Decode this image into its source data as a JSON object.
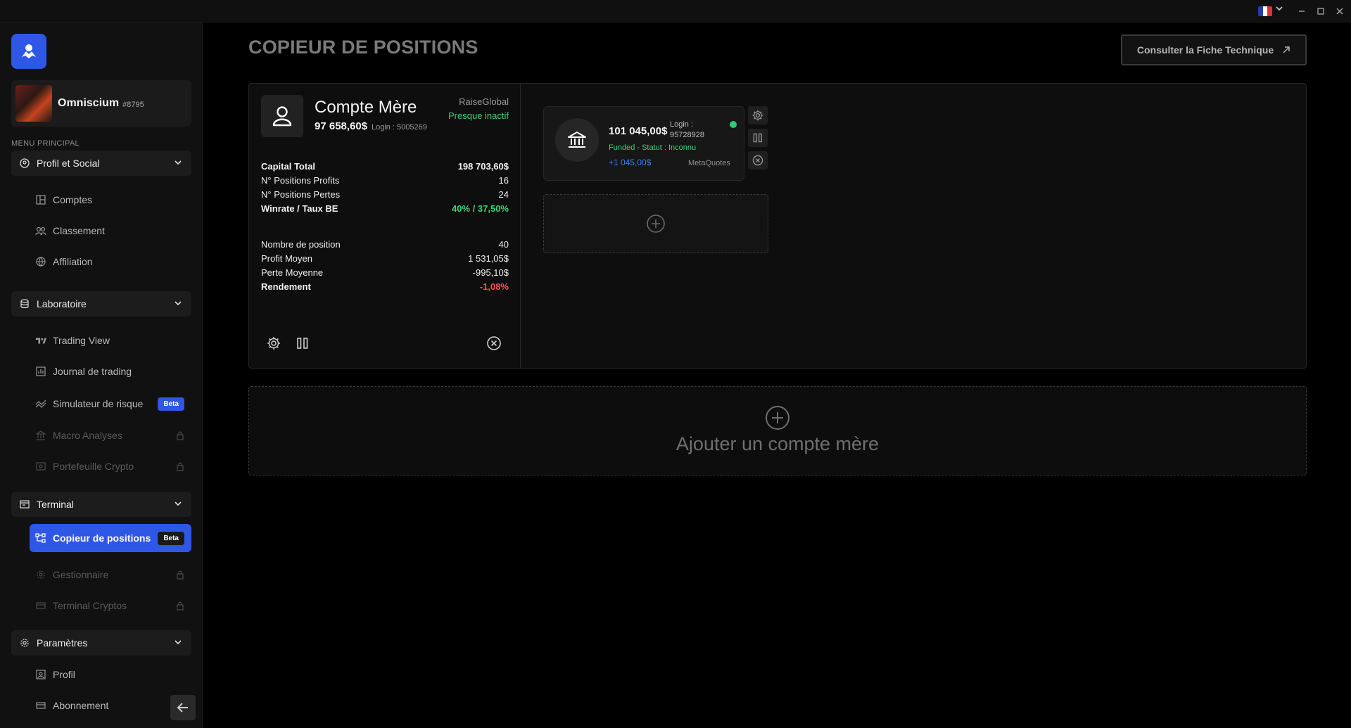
{
  "window": {
    "language": "FR"
  },
  "sidebar": {
    "user": {
      "name": "Omniscium",
      "tag": "#8795"
    },
    "menu_heading": "MENU PRINCIPAL",
    "groups": {
      "profil": {
        "label": "Profil et Social"
      },
      "labo": {
        "label": "Laboratoire"
      },
      "terminal": {
        "label": "Terminal"
      },
      "params": {
        "label": "Paramètres"
      }
    },
    "items": {
      "comptes": "Comptes",
      "classement": "Classement",
      "affiliation": "Affiliation",
      "trading_view": "Trading View",
      "journal": "Journal de trading",
      "simulateur": "Simulateur de risque",
      "macro": "Macro Analyses",
      "portefeuille": "Portefeuille Crypto",
      "copieur": "Copieur de positions",
      "gestionnaire": "Gestionnaire",
      "terminal_cryptos": "Terminal Cryptos",
      "profil": "Profil",
      "abonnement": "Abonnement"
    },
    "beta_label": "Beta"
  },
  "main": {
    "title": "COPIEUR DE POSITIONS",
    "tech_button": "Consulter la Fiche Technique",
    "mother_account": {
      "title": "Compte Mère",
      "balance": "97 658,60$",
      "login": "Login : 5005269",
      "broker": "RaiseGlobal",
      "status": "Presque inactif",
      "stats_a": [
        {
          "label": "Capital Total",
          "value": "198 703,60$"
        },
        {
          "label": "N° Positions Profits",
          "value": "16"
        },
        {
          "label": "N° Positions Pertes",
          "value": "24"
        },
        {
          "label": "Winrate / Taux BE",
          "value": "40% / 37,50%"
        }
      ],
      "stats_b": [
        {
          "label": "Nombre de position",
          "value": "40"
        },
        {
          "label": "Profit Moyen",
          "value": "1 531,05$"
        },
        {
          "label": "Perte Moyenne",
          "value": "-995,10$"
        },
        {
          "label": "Rendement",
          "value": "-1,08%"
        }
      ]
    },
    "child_account": {
      "balance": "101 045,00$",
      "login_label": "Login :",
      "login_value": "95728928",
      "status": "Funded - Statut : Inconnu",
      "profit": "+1 045,00$",
      "platform": "MetaQuotes"
    },
    "add_mother_label": "Ajouter un compte mère"
  },
  "colors": {
    "accent": "#2f57e6",
    "positive": "#3ed277",
    "negative": "#f2554f",
    "profit_blue": "#3d7cf5"
  }
}
